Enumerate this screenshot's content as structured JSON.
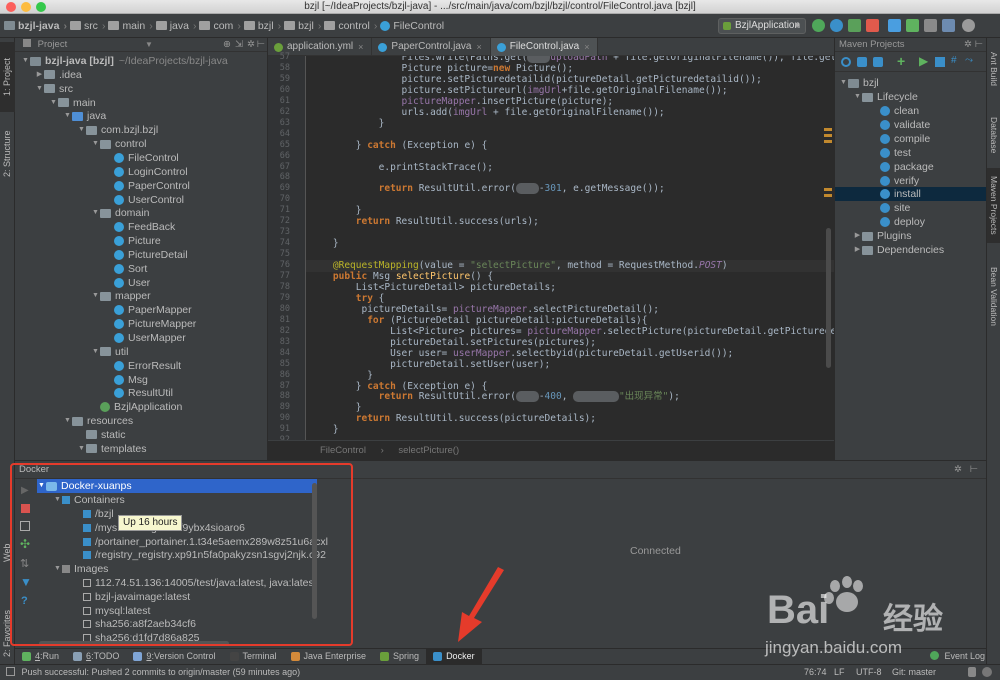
{
  "window": {
    "title": "bzjl [~/IdeaProjects/bzjl-java] - .../src/main/java/com/bzjl/bzjl/control/FileControl.java [bzjl]"
  },
  "breadcrumbs": [
    "bzjl-java",
    "src",
    "main",
    "java",
    "com",
    "bzjl",
    "bzjl",
    "control",
    "FileControl"
  ],
  "toolbar": {
    "run_config": "BzjlApplication"
  },
  "left_strip": {
    "project_tab": "1: Project",
    "structure_tab": "2: Structure",
    "web_tab": "Web",
    "favorites_tab": "2: Favorites"
  },
  "project_panel": {
    "header": "Project",
    "rows": [
      {
        "label": "bzjl-java [bzjl]",
        "suffix": "~/IdeaProjects/bzjl-java",
        "bold": true,
        "indent": 0,
        "expanded": true,
        "kind": "module"
      },
      {
        "label": ".idea",
        "indent": 1,
        "expanded": false,
        "kind": "folder"
      },
      {
        "label": "src",
        "indent": 1,
        "expanded": true,
        "kind": "folder"
      },
      {
        "label": "main",
        "indent": 2,
        "expanded": true,
        "kind": "folder"
      },
      {
        "label": "java",
        "indent": 3,
        "expanded": true,
        "kind": "src"
      },
      {
        "label": "com.bzjl.bzjl",
        "indent": 4,
        "expanded": true,
        "kind": "folder"
      },
      {
        "label": "control",
        "indent": 5,
        "expanded": true,
        "kind": "folder"
      },
      {
        "label": "FileControl",
        "indent": 6,
        "kind": "class"
      },
      {
        "label": "LoginControl",
        "indent": 6,
        "kind": "class"
      },
      {
        "label": "PaperControl",
        "indent": 6,
        "kind": "class"
      },
      {
        "label": "UserControl",
        "indent": 6,
        "kind": "class"
      },
      {
        "label": "domain",
        "indent": 5,
        "expanded": true,
        "kind": "folder"
      },
      {
        "label": "FeedBack",
        "indent": 6,
        "kind": "class"
      },
      {
        "label": "Picture",
        "indent": 6,
        "kind": "class"
      },
      {
        "label": "PictureDetail",
        "indent": 6,
        "kind": "class"
      },
      {
        "label": "Sort",
        "indent": 6,
        "kind": "class"
      },
      {
        "label": "User",
        "indent": 6,
        "kind": "class"
      },
      {
        "label": "mapper",
        "indent": 5,
        "expanded": true,
        "kind": "folder"
      },
      {
        "label": "PaperMapper",
        "indent": 6,
        "kind": "class"
      },
      {
        "label": "PictureMapper",
        "indent": 6,
        "kind": "class"
      },
      {
        "label": "UserMapper",
        "indent": 6,
        "kind": "class"
      },
      {
        "label": "util",
        "indent": 5,
        "expanded": true,
        "kind": "folder"
      },
      {
        "label": "ErrorResult",
        "indent": 6,
        "kind": "class"
      },
      {
        "label": "Msg",
        "indent": 6,
        "kind": "class"
      },
      {
        "label": "ResultUtil",
        "indent": 6,
        "kind": "class"
      },
      {
        "label": "BzjlApplication",
        "indent": 5,
        "kind": "class"
      },
      {
        "label": "resources",
        "indent": 3,
        "expanded": true,
        "kind": "folder"
      },
      {
        "label": "static",
        "indent": 4,
        "kind": "folder"
      },
      {
        "label": "templates",
        "indent": 4,
        "expanded": true,
        "kind": "folder"
      }
    ]
  },
  "editor": {
    "tabs": [
      {
        "label": "application.yml",
        "active": false
      },
      {
        "label": "PaperControl.java",
        "active": false
      },
      {
        "label": "FileControl.java",
        "active": true
      }
    ],
    "breadcrumb": [
      "FileControl",
      "selectPicture()"
    ],
    "highlight_line": 76,
    "lines": [
      {
        "n": 57,
        "t": "                Files.write(Paths.get(",
        "blur1": "xxxx",
        "t2": "uploadPath + file.getOriginalFilename()), file.getBytes("
      },
      {
        "n": 58,
        "t": "                Picture picture=new Picture();"
      },
      {
        "n": 59,
        "t": "                picture.setPicturedetailid(pictureDetail.getPicturedetailid());"
      },
      {
        "n": 60,
        "t": "                picture.setPictureurl(imgUrl+file.getOriginalFilename());"
      },
      {
        "n": 61,
        "t": "                pictureMapper.insertPicture(picture);"
      },
      {
        "n": 62,
        "t": "                urls.add(imgUrl + file.getOriginalFilename());"
      },
      {
        "n": 63,
        "t": "            }"
      },
      {
        "n": 64,
        "t": ""
      },
      {
        "n": 65,
        "t": "        } catch (Exception e) {"
      },
      {
        "n": 66,
        "t": ""
      },
      {
        "n": 67,
        "t": "            e.printStackTrace();"
      },
      {
        "n": 68,
        "t": ""
      },
      {
        "n": 69,
        "t": "            return ResultUtil.error(",
        "blur1": "xxxx",
        "t2": "-301, e.getMessage());"
      },
      {
        "n": 70,
        "t": ""
      },
      {
        "n": 71,
        "t": "        }"
      },
      {
        "n": 72,
        "t": "        return ResultUtil.success(urls);"
      },
      {
        "n": 73,
        "t": ""
      },
      {
        "n": 74,
        "t": "    }"
      },
      {
        "n": 75,
        "t": ""
      },
      {
        "n": 76,
        "t": "    @RequestMapping(value = \"selectPicture\", method = RequestMethod.POST)"
      },
      {
        "n": 77,
        "t": "    public Msg selectPicture() {"
      },
      {
        "n": 78,
        "t": "        List<PictureDetail> pictureDetails;"
      },
      {
        "n": 79,
        "t": "        try {"
      },
      {
        "n": 80,
        "t": "         pictureDetails= pictureMapper.selectPictureDetail();"
      },
      {
        "n": 81,
        "t": "          for (PictureDetail pictureDetail:pictureDetails){"
      },
      {
        "n": 82,
        "t": "              List<Picture> pictures= pictureMapper.selectPicture(pictureDetail.getPicturedetailid());"
      },
      {
        "n": 83,
        "t": "              pictureDetail.setPictures(pictures);"
      },
      {
        "n": 84,
        "t": "              User user= userMapper.selectbyid(pictureDetail.getUserid());"
      },
      {
        "n": 85,
        "t": "              pictureDetail.setUser(user);"
      },
      {
        "n": 86,
        "t": "          }"
      },
      {
        "n": 87,
        "t": "        } catch (Exception e) {"
      },
      {
        "n": 88,
        "t": "            return ResultUtil.error(",
        "blur1": "xxxx",
        "t2": "-400, ",
        "blur2": "xxxxxxxx",
        "t3": "\"出现异常\");"
      },
      {
        "n": 89,
        "t": "        }"
      },
      {
        "n": 90,
        "t": "        return ResultUtil.success(pictureDetails);"
      },
      {
        "n": 91,
        "t": "    }"
      },
      {
        "n": 92,
        "t": ""
      }
    ]
  },
  "maven_panel": {
    "header": "Maven Projects",
    "root": "bzjl",
    "lifecycle_label": "Lifecycle",
    "goals": [
      "clean",
      "validate",
      "compile",
      "test",
      "package",
      "verify",
      "install",
      "site",
      "deploy"
    ],
    "selected_goal": "install",
    "plugins_label": "Plugins",
    "dependencies_label": "Dependencies"
  },
  "right_strip": {
    "ant_build": "Ant Build",
    "database": "Database",
    "maven_projects": "Maven Projects",
    "bean_validation": "Bean Validation"
  },
  "docker_panel": {
    "header": "Docker",
    "server": "Docker-xuanps",
    "containers_label": "Containers",
    "containers": [
      "/bzjl",
      "/mys",
      "/portainer_portainer.1.t34e5aemx289w8z51u6acxl",
      "/registry_registry.xp91n5fa0pakyzsn1sgvj2njk.c92"
    ],
    "container_hidden_suffix": "3g1m6lf9ybx4sioaro6",
    "tooltip": "Up 16 hours",
    "images_label": "Images",
    "images": [
      "112.74.51.136:14005/test/java:latest, java:latest",
      "bzjl-javaimage:latest",
      "mysql:latest",
      "sha256:a8f2aeb34cf6",
      "sha256:d1fd7d86a825"
    ],
    "status": "Connected"
  },
  "bottom_tabs": [
    {
      "key": "4",
      "label": "Run",
      "active": false
    },
    {
      "key": "6",
      "label": "TODO",
      "active": false
    },
    {
      "key": "9",
      "label": "Version Control",
      "active": false
    },
    {
      "key": "",
      "label": "Terminal",
      "active": false
    },
    {
      "key": "",
      "label": "Java Enterprise",
      "active": false
    },
    {
      "key": "",
      "label": "Spring",
      "active": false
    },
    {
      "key": "",
      "label": "Docker",
      "active": true
    }
  ],
  "event_log_label": "Event Log",
  "status_bar": {
    "message": "Push successful: Pushed 2 commits to origin/master (59 minutes ago)",
    "position": "76:74",
    "line_sep": "LF",
    "encoding": "UTF-8",
    "git": "Git: master"
  },
  "watermark": {
    "brand": "Bai",
    "brand2": "经验",
    "url": "jingyan.baidu.com"
  },
  "colors": {
    "accent": "#2f65ca",
    "annotation_red": "#e53b2b",
    "editor_bg": "#2b2b2b",
    "panel_bg": "#3c3f41"
  }
}
